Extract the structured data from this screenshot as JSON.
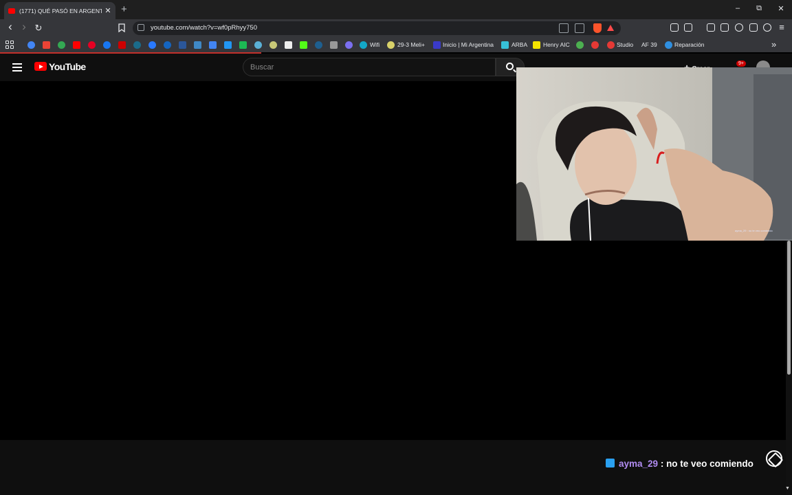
{
  "browser": {
    "tab_title": "(1771) QUÉ PASÓ EN ARGENTIN...",
    "tab_close": "✕",
    "new_tab": "+",
    "url": "youtube.com/watch?v=wf0pRhyy750",
    "window_controls": {
      "minimize": "–",
      "maximize": "⧉",
      "close": "✕"
    },
    "nav": {
      "back": "‹",
      "forward": "›",
      "reload": "↻"
    }
  },
  "bookmarks": [
    {
      "label": "Wifi"
    },
    {
      "label": "29-3 Meli+"
    },
    {
      "label": "Inicio | Mi Argentina"
    },
    {
      "label": "ARBA"
    },
    {
      "label": "Henry AIC"
    },
    {
      "label": "Studio"
    },
    {
      "label": "AF 39"
    },
    {
      "label": "Reparación"
    }
  ],
  "bookmarks_more": "»",
  "youtube": {
    "logo_text": "YouTube",
    "search_placeholder": "Buscar",
    "create_label": "Crear",
    "notifications_badge": "9+"
  },
  "chat": {
    "user": "ayma_29",
    "separator": " : ",
    "message": "no te veo comiendo"
  },
  "overlay_caption": "ayma_29 : no te veo comiendo",
  "colors": {
    "youtube_red": "#ff0000",
    "chat_username": "#b18cf2",
    "chat_icon": "#2aa0f0",
    "browser_chrome": "#35363a"
  }
}
